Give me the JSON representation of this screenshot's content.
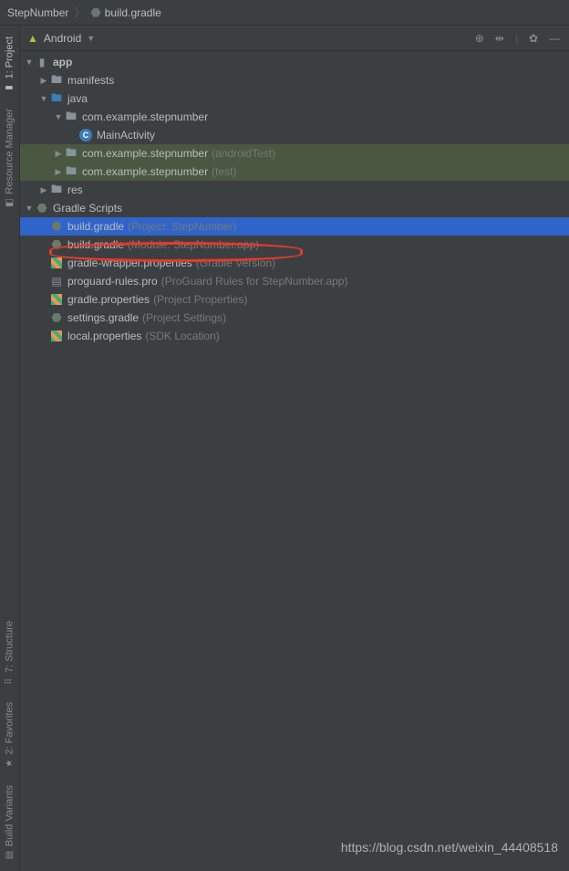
{
  "breadcrumb": {
    "project": "StepNumber",
    "file": "build.gradle"
  },
  "panel": {
    "title": "Android"
  },
  "leftTabs": {
    "project": "1: Project",
    "resourceManager": "Resource Manager",
    "structure": "7: Structure",
    "favorites": "2: Favorites",
    "buildVariants": "Build Variants"
  },
  "tree": {
    "app": "app",
    "manifests": "manifests",
    "java": "java",
    "pkg1": "com.example.stepnumber",
    "mainActivity": "MainActivity",
    "pkg2": "com.example.stepnumber",
    "pkg2hint": "(androidTest)",
    "pkg3": "com.example.stepnumber",
    "pkg3hint": "(test)",
    "res": "res",
    "gradleScripts": "Gradle Scripts",
    "bg1": "build.gradle",
    "bg1hint": "(Project: StepNumber)",
    "bg2": "build.gradle",
    "bg2hint": "(Module: StepNumber.app)",
    "gwp": "gradle-wrapper.properties",
    "gwphint": "(Gradle Version)",
    "pgr": "proguard-rules.pro",
    "pgrhint": "(ProGuard Rules for StepNumber.app)",
    "gp": "gradle.properties",
    "gphint": "(Project Properties)",
    "sg": "settings.gradle",
    "sghint": "(Project Settings)",
    "lp": "local.properties",
    "lphint": "(SDK Location)"
  },
  "watermark": "https://blog.csdn.net/weixin_44408518"
}
